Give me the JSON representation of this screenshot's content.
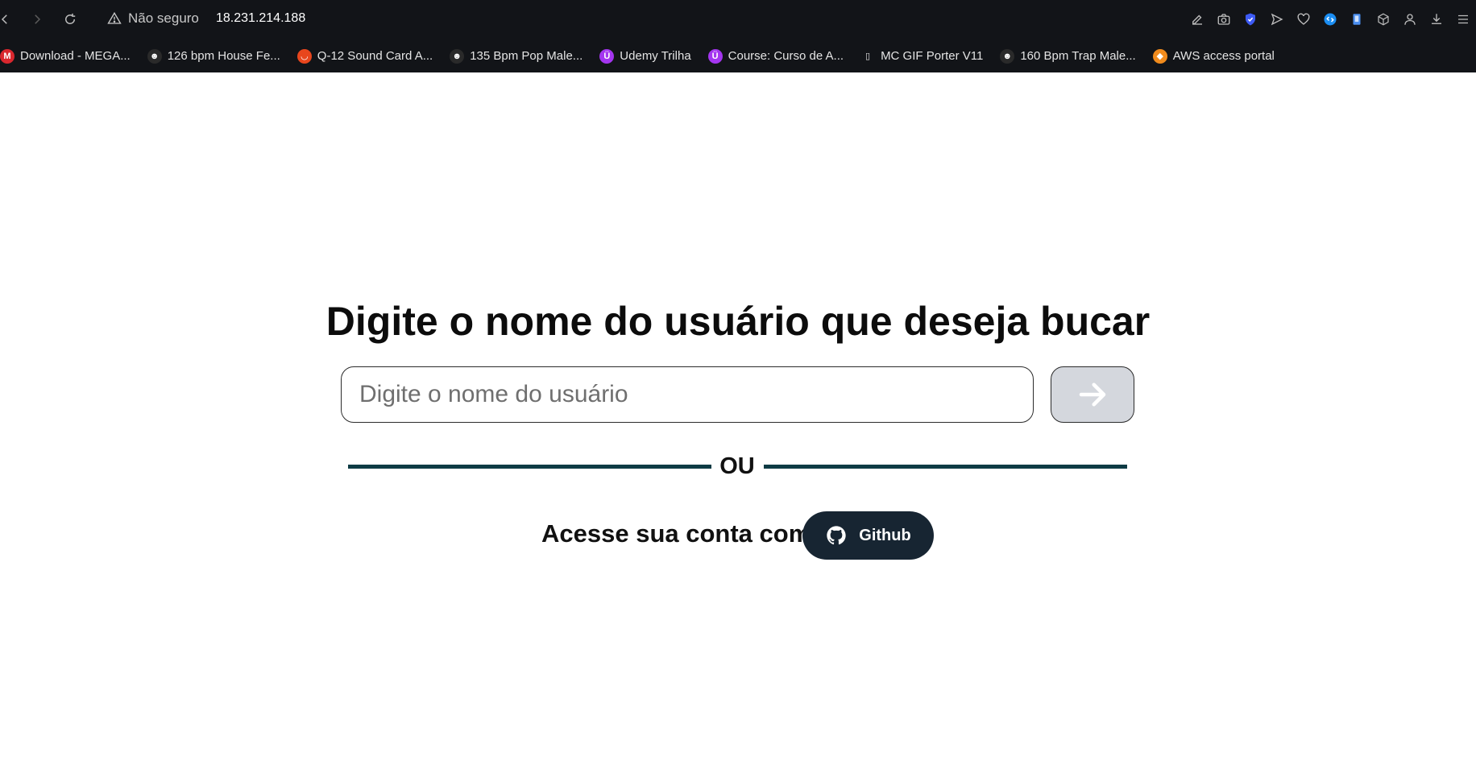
{
  "browser": {
    "security_label": "Não seguro",
    "url": "18.231.214.188",
    "bookmarks": [
      {
        "label": "Download - MEGA...",
        "icon": "mega-icon",
        "color": "#d9272e",
        "glyph": "M"
      },
      {
        "label": "126 bpm House Fe...",
        "icon": "character-icon",
        "color": "#2a2a2a",
        "glyph": "☻"
      },
      {
        "label": "Q-12 Sound Card A...",
        "icon": "shopping-bag-icon",
        "color": "#e8461d",
        "glyph": "◡"
      },
      {
        "label": "135 Bpm Pop Male...",
        "icon": "character-icon",
        "color": "#2a2a2a",
        "glyph": "☻"
      },
      {
        "label": "Udemy Trilha",
        "icon": "udemy-icon",
        "color": "#a435f0",
        "glyph": "Ü"
      },
      {
        "label": "Course: Curso de A...",
        "icon": "udemy-icon",
        "color": "#a435f0",
        "glyph": "Ü"
      },
      {
        "label": "MC GIF Porter V11",
        "icon": "file-icon",
        "color": "#121418",
        "glyph": "▯"
      },
      {
        "label": "160 Bpm Trap Male...",
        "icon": "character-icon",
        "color": "#2a2a2a",
        "glyph": "☻"
      },
      {
        "label": "AWS access portal",
        "icon": "aws-cube-icon",
        "color": "#f08b1d",
        "glyph": "◆"
      }
    ]
  },
  "page": {
    "title": "Digite o nome do usuário que deseja bucar",
    "search_placeholder": "Digite o nome do usuário",
    "search_value": "",
    "divider_text": "OU",
    "login_prompt": "Acesse sua conta com",
    "github_label": "Github"
  },
  "colors": {
    "chrome_bg": "#121418",
    "go_button_bg": "#d4d7dd",
    "divider": "#0e3b44",
    "github_button_bg": "#172532"
  }
}
